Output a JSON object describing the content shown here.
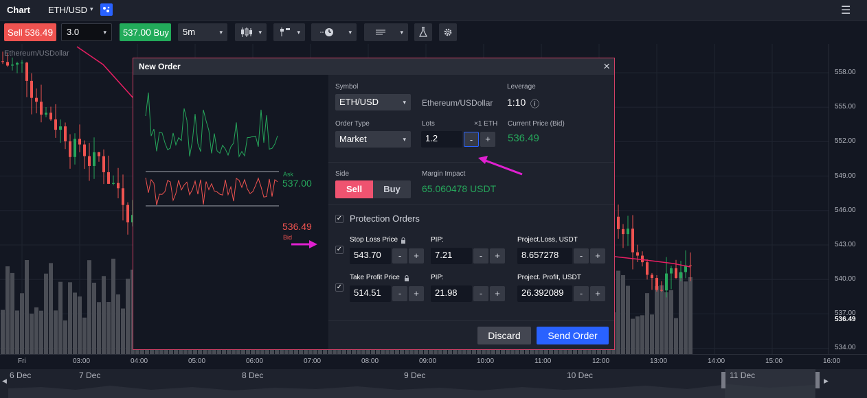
{
  "topbar": {
    "title": "Chart",
    "symbol": "ETH/USD",
    "symbol_caret": "▾",
    "compare_icon": "compare-icon",
    "menu_icon": "☰"
  },
  "toolbar": {
    "sell_label": "Sell",
    "sell_price_main": "536.",
    "sell_price_big": "49",
    "quantity": "3.0",
    "buy_price_main": "537.",
    "buy_price_big": "00",
    "buy_label": "Buy",
    "interval": "5m",
    "caret": "▾",
    "icons": [
      "candles-icon",
      "indicators-icon",
      "time-icon",
      "settings-lines-icon",
      "flask-icon",
      "gear-icon"
    ]
  },
  "chart": {
    "legend": "Ethereum/USDollar",
    "price_ticks": [
      "558.00",
      "555.00",
      "552.00",
      "549.00",
      "546.00",
      "543.00",
      "540.00",
      "537.00",
      "534.00"
    ],
    "current_price": "536.49",
    "time_ticks": [
      "Fri",
      "03:00",
      "04:00",
      "05:00",
      "06:00",
      "07:00",
      "08:00",
      "09:00",
      "10:00",
      "11:00",
      "12:00",
      "13:00",
      "14:00",
      "15:00",
      "16:00"
    ],
    "navigator_dates": [
      "6 Dec",
      "7 Dec",
      "8 Dec",
      "9 Dec",
      "10 Dec",
      "11 Dec"
    ],
    "colors": {
      "up": "#26a65b",
      "down": "#ef5350",
      "ma": "#e91e63",
      "volume": "#4a4d55"
    }
  },
  "modal": {
    "title": "New Order",
    "close_icon": "×",
    "mini_chart": {
      "ask_label": "Ask",
      "ask_value": "537.00",
      "bid_value": "536.49",
      "bid_label": "Bid"
    },
    "symbol": {
      "label": "Symbol",
      "value": "ETH/USD",
      "description": "Ethereum/USDollar"
    },
    "leverage": {
      "label": "Leverage",
      "value": "1:10",
      "info_icon": "ⓘ"
    },
    "order_type": {
      "label": "Order Type",
      "value": "Market"
    },
    "lots": {
      "label": "Lots",
      "unit": "×1 ETH",
      "value": "1.2",
      "minus": "-",
      "plus": "+"
    },
    "current_price": {
      "label": "Current Price (Bid)",
      "value": "536.49"
    },
    "side": {
      "label": "Side",
      "sell": "Sell",
      "buy": "Buy"
    },
    "margin": {
      "label": "Margin Impact",
      "value": "65.060478 USDT"
    },
    "protection": {
      "label": "Protection Orders",
      "check": "✓"
    },
    "stop_loss": {
      "label": "Stop Loss Price",
      "price": "543.70",
      "pip_label": "PIP:",
      "pip": "7.21",
      "proj_label": "Project.Loss, USDT",
      "proj": "8.657278",
      "check": "✓"
    },
    "take_profit": {
      "label": "Take Profit Price",
      "price": "514.51",
      "pip_label": "PIP:",
      "pip": "21.98",
      "proj_label": "Project. Profit, USDT",
      "proj": "26.392089",
      "check": "✓"
    },
    "buttons": {
      "minus": "-",
      "plus": "+",
      "discard": "Discard",
      "send": "Send Order"
    }
  },
  "annotations": {
    "arrow_color": "#e020d0"
  }
}
